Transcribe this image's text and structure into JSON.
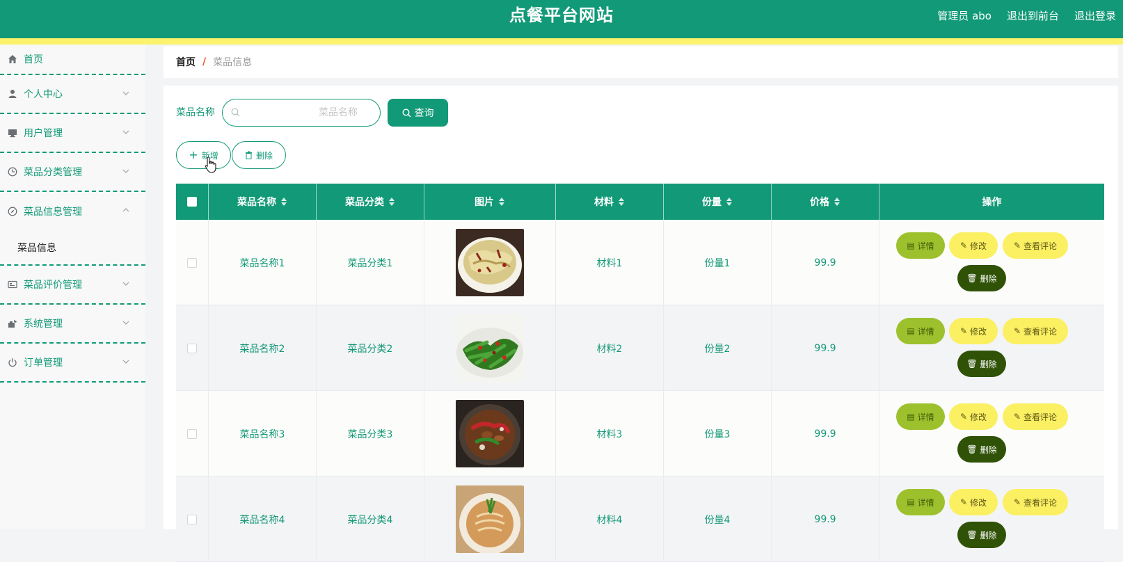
{
  "header": {
    "title": "点餐平台网站",
    "user_label": "管理员 abo",
    "front_link": "退出到前台",
    "logout_link": "退出登录"
  },
  "sidebar": {
    "items": [
      {
        "label": "首页",
        "icon": "home-icon"
      },
      {
        "label": "个人中心",
        "icon": "user-icon"
      },
      {
        "label": "用户管理",
        "icon": "monitor-icon"
      },
      {
        "label": "菜品分类管理",
        "icon": "clock-icon"
      },
      {
        "label": "菜品信息管理",
        "icon": "compass-icon"
      },
      {
        "label": "菜品评价管理",
        "icon": "card-icon"
      },
      {
        "label": "系统管理",
        "icon": "tool-icon"
      },
      {
        "label": "订单管理",
        "icon": "power-icon"
      }
    ],
    "sub_item": "菜品信息"
  },
  "breadcrumb": {
    "home": "首页",
    "separator": "/",
    "current": "菜品信息"
  },
  "search": {
    "label": "菜品名称",
    "placeholder": "菜品名称",
    "value": "",
    "query_label": "查询"
  },
  "actions": {
    "add_label": "新增",
    "delete_label": "删除"
  },
  "table": {
    "headers": [
      "菜品名称",
      "菜品分类",
      "图片",
      "材料",
      "份量",
      "价格",
      "操作"
    ],
    "rows": [
      {
        "name": "菜品名称1",
        "category": "菜品分类1",
        "image": "stir-fried-cabbage",
        "material": "材料1",
        "portion": "份量1",
        "price": "99.9"
      },
      {
        "name": "菜品名称2",
        "category": "菜品分类2",
        "image": "green-beans-chili",
        "material": "材料2",
        "portion": "份量2",
        "price": "99.9"
      },
      {
        "name": "菜品名称3",
        "category": "菜品分类3",
        "image": "braised-meat-peppers",
        "material": "材料3",
        "portion": "份量3",
        "price": "99.9"
      },
      {
        "name": "菜品名称4",
        "category": "菜品分类4",
        "image": "noodle-dish",
        "material": "材料4",
        "portion": "份量4",
        "price": "99.9"
      }
    ],
    "ops": {
      "detail": "详情",
      "edit": "修改",
      "review": "查看评论",
      "delete": "删除"
    }
  },
  "colors": {
    "primary": "#129977",
    "yellow": "#faf062",
    "detail_green": "#9dc12d",
    "delete_dark": "#2f5207"
  }
}
